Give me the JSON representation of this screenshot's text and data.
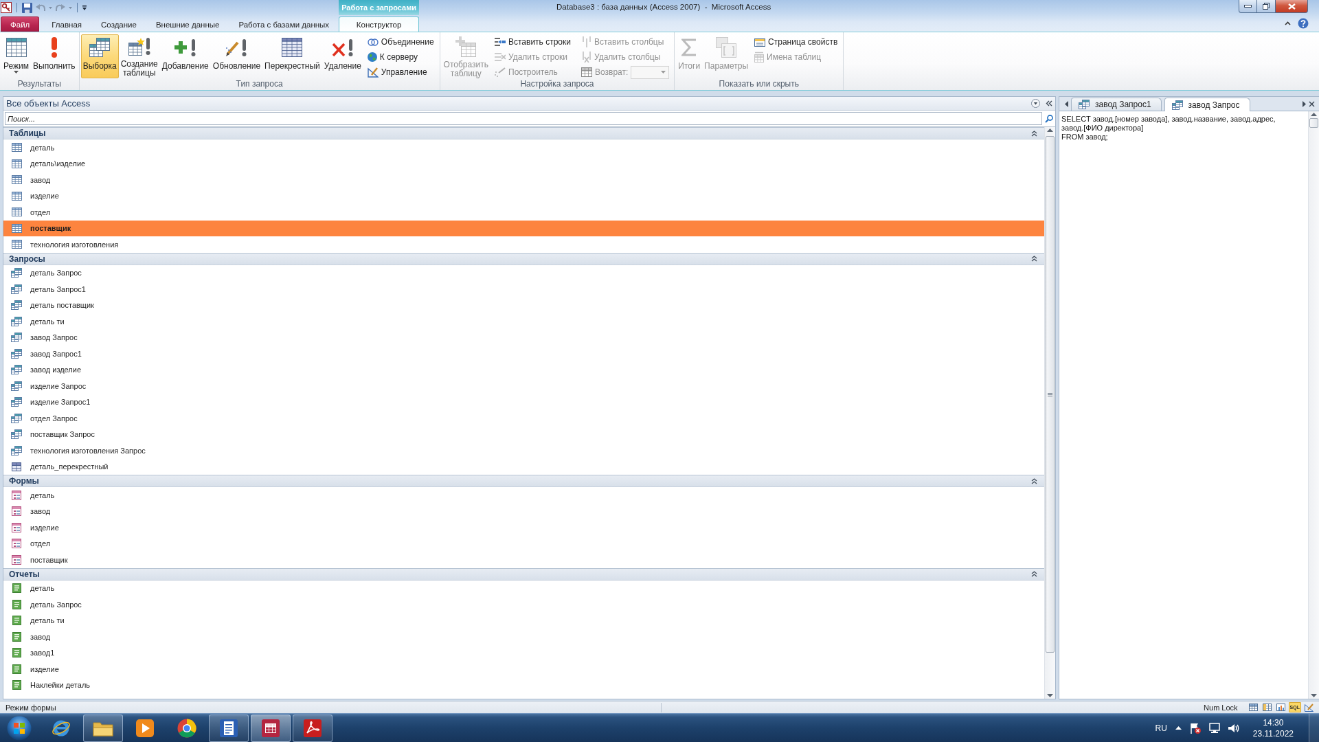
{
  "window": {
    "title": "Database3 : база данных (Access 2007)  -  Microsoft Access"
  },
  "context_tab_group": {
    "label": "Работа с запросами"
  },
  "ribbon_tabs": [
    {
      "label": "Файл",
      "kind": "file",
      "selected": false
    },
    {
      "label": "Главная",
      "kind": "tab",
      "selected": false
    },
    {
      "label": "Создание",
      "kind": "tab",
      "selected": false
    },
    {
      "label": "Внешние данные",
      "kind": "tab",
      "selected": false
    },
    {
      "label": "Работа с базами данных",
      "kind": "tab",
      "selected": false
    },
    {
      "label": "Конструктор",
      "kind": "context",
      "selected": true
    }
  ],
  "ribbon_groups": [
    {
      "label": "Результаты",
      "controls": [
        {
          "kind": "large-split",
          "label": "Режим",
          "disabled": false
        },
        {
          "kind": "large",
          "label": "Выполнить",
          "disabled": false
        }
      ]
    },
    {
      "label": "Тип запроса",
      "controls": [
        {
          "kind": "large",
          "label": "Выборка",
          "selected": true,
          "disabled": false
        },
        {
          "kind": "large",
          "label": "Создание таблицы",
          "selected": false,
          "disabled": false
        },
        {
          "kind": "large",
          "label": "Добавление",
          "selected": false,
          "disabled": false
        },
        {
          "kind": "large",
          "label": "Обновление",
          "selected": false,
          "disabled": false
        },
        {
          "kind": "large",
          "label": "Перекрестный",
          "selected": false,
          "disabled": false
        },
        {
          "kind": "large",
          "label": "Удаление",
          "selected": false,
          "disabled": false
        },
        {
          "kind": "small",
          "label": "Объединение",
          "selected": false,
          "disabled": false
        },
        {
          "kind": "small",
          "label": "К серверу",
          "selected": false,
          "disabled": false
        },
        {
          "kind": "small",
          "label": "Управление",
          "selected": false,
          "disabled": false
        }
      ]
    },
    {
      "label": "Настройка запроса",
      "controls": [
        {
          "kind": "large",
          "label": "Отобразить таблицу",
          "disabled": true
        },
        {
          "kind": "small",
          "label": "Вставить строки",
          "disabled": false
        },
        {
          "kind": "small",
          "label": "Удалить строки",
          "disabled": true
        },
        {
          "kind": "small",
          "label": "Построитель",
          "disabled": true
        },
        {
          "kind": "small",
          "label": "Вставить столбцы",
          "disabled": true
        },
        {
          "kind": "small",
          "label": "Удалить столбцы",
          "disabled": true
        },
        {
          "kind": "combo",
          "label": "Возврат:",
          "disabled": true
        }
      ]
    },
    {
      "label": "Показать или скрыть",
      "controls": [
        {
          "kind": "large",
          "label": "Итоги",
          "disabled": true
        },
        {
          "kind": "large",
          "label": "Параметры",
          "disabled": true
        },
        {
          "kind": "small",
          "label": "Страница свойств",
          "disabled": false
        },
        {
          "kind": "small",
          "label": "Имена таблиц",
          "disabled": true
        }
      ]
    }
  ],
  "navigation_pane": {
    "title": "Все объекты Access",
    "search": {
      "placeholder": "Поиск..."
    },
    "sections": [
      {
        "label": "Таблицы",
        "expanded": true,
        "items": [
          {
            "label": "деталь",
            "kind": "table",
            "selected": false
          },
          {
            "label": "деталь\\изделие",
            "kind": "table",
            "selected": false
          },
          {
            "label": "завод",
            "kind": "table",
            "selected": false
          },
          {
            "label": "изделие",
            "kind": "table",
            "selected": false
          },
          {
            "label": "отдел",
            "kind": "table",
            "selected": false
          },
          {
            "label": "поставщик",
            "kind": "table",
            "selected": true
          },
          {
            "label": "технология изготовления",
            "kind": "table",
            "selected": false
          }
        ]
      },
      {
        "label": "Запросы",
        "expanded": true,
        "items": [
          {
            "label": "деталь Запрос",
            "kind": "query",
            "selected": false
          },
          {
            "label": "деталь Запрос1",
            "kind": "query",
            "selected": false
          },
          {
            "label": "деталь поставщик",
            "kind": "query",
            "selected": false
          },
          {
            "label": "деталь ти",
            "kind": "query",
            "selected": false
          },
          {
            "label": "завод Запрос",
            "kind": "query",
            "selected": false
          },
          {
            "label": "завод Запрос1",
            "kind": "query",
            "selected": false
          },
          {
            "label": "завод изделие",
            "kind": "query",
            "selected": false
          },
          {
            "label": "изделие Запрос",
            "kind": "query",
            "selected": false
          },
          {
            "label": "изделие Запрос1",
            "kind": "query",
            "selected": false
          },
          {
            "label": "отдел Запрос",
            "kind": "query",
            "selected": false
          },
          {
            "label": "поставщик Запрос",
            "kind": "query",
            "selected": false
          },
          {
            "label": "технология изготовления Запрос",
            "kind": "query",
            "selected": false
          },
          {
            "label": "деталь_перекрестный",
            "kind": "crosstab",
            "selected": false
          }
        ]
      },
      {
        "label": "Формы",
        "expanded": true,
        "items": [
          {
            "label": "деталь",
            "kind": "form",
            "selected": false
          },
          {
            "label": "завод",
            "kind": "form",
            "selected": false
          },
          {
            "label": "изделие",
            "kind": "form",
            "selected": false
          },
          {
            "label": "отдел",
            "kind": "form",
            "selected": false
          },
          {
            "label": "поставщик",
            "kind": "form",
            "selected": false
          }
        ]
      },
      {
        "label": "Отчеты",
        "expanded": true,
        "items": [
          {
            "label": "деталь",
            "kind": "report",
            "selected": false
          },
          {
            "label": "деталь Запрос",
            "kind": "report",
            "selected": false
          },
          {
            "label": "деталь ти",
            "kind": "report",
            "selected": false
          },
          {
            "label": "завод",
            "kind": "report",
            "selected": false
          },
          {
            "label": "завод1",
            "kind": "report",
            "selected": false
          },
          {
            "label": "изделие",
            "kind": "report",
            "selected": false
          },
          {
            "label": "Наклейки деталь",
            "kind": "report",
            "selected": false
          }
        ]
      }
    ]
  },
  "document": {
    "tabs": [
      {
        "label": "завод Запрос1",
        "selected": false
      },
      {
        "label": "завод Запрос",
        "selected": true
      }
    ],
    "sql": "SELECT завод.[номер завода], завод.название, завод.адрес, завод.[ФИО директора]\nFROM завод;"
  },
  "status_bar": {
    "mode": "Режим формы",
    "indicators": [
      "Num Lock"
    ],
    "view_buttons": [
      {
        "selected": false
      },
      {
        "selected": false
      },
      {
        "selected": false
      },
      {
        "label": "SQL",
        "selected": true
      },
      {
        "selected": false
      }
    ]
  },
  "taskbar": {
    "apps": [
      {
        "running": false,
        "selected": false
      },
      {
        "running": true,
        "selected": false
      },
      {
        "running": false,
        "selected": false
      },
      {
        "running": false,
        "selected": false
      },
      {
        "running": true,
        "selected": false
      },
      {
        "running": true,
        "selected": true
      },
      {
        "running": true,
        "selected": false
      }
    ],
    "language": "RU",
    "clock": {
      "time": "14:30",
      "date": "23.11.2022"
    }
  }
}
